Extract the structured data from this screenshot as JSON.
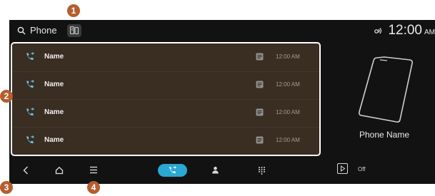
{
  "topbar": {
    "title": "Phone",
    "clock": "12:00",
    "ampm": "AM"
  },
  "calls": [
    {
      "name": "Name",
      "time": "12:00 AM"
    },
    {
      "name": "Name",
      "time": "12:00 AM"
    },
    {
      "name": "Name",
      "time": "12:00 AM"
    },
    {
      "name": "Name",
      "time": "12:00 AM"
    }
  ],
  "device": {
    "name": "Phone Name"
  },
  "media": {
    "status": "Off"
  },
  "callouts": [
    "1",
    "2",
    "3",
    "4"
  ],
  "colors": {
    "accent": "#2aa8d4",
    "callout": "#b55d2e",
    "list_background": "#3a2d22",
    "screen_background": "#121212"
  }
}
